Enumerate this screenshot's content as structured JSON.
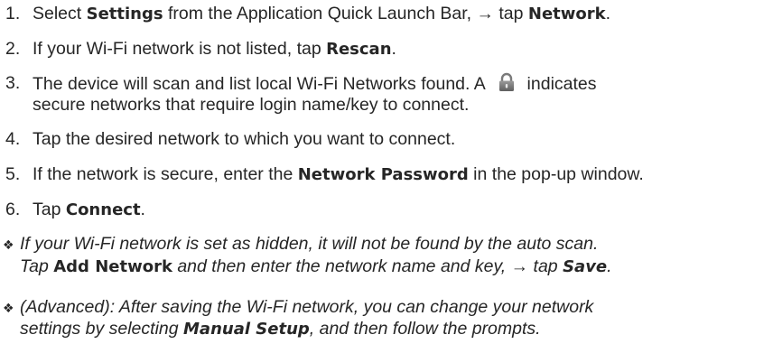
{
  "steps": [
    {
      "num": "1.",
      "parts": [
        "Select ",
        "Settings",
        " from the Application Quick Launch Bar, → tap ",
        "Network",
        "."
      ]
    },
    {
      "num": "2.",
      "parts": [
        "If your Wi-Fi network is not listed, tap ",
        "Rescan",
        "."
      ]
    },
    {
      "num": "3.",
      "line1": [
        "The device will scan and list local Wi-Fi Networks found. A ",
        " indicates"
      ],
      "line2": "secure networks that require login name/key to connect.",
      "icon": "padlock-icon"
    },
    {
      "num": "4.",
      "parts": [
        "Tap the desired network to which you want to connect."
      ]
    },
    {
      "num": "5.",
      "parts": [
        "If the network is secure, enter the ",
        "Network Password",
        " in the pop-up window."
      ]
    },
    {
      "num": "6.",
      "parts": [
        "Tap ",
        "Connect",
        "."
      ]
    }
  ],
  "notes": [
    {
      "bullet": "❖",
      "line1": "If your Wi-Fi network is set as hidden, it will not be found by the auto scan.",
      "line2": [
        "Tap ",
        "Add Network",
        " and then enter the network name and key, → tap ",
        "Save",
        "."
      ]
    },
    {
      "bullet": "❖",
      "line1": "(Advanced): After saving the Wi-Fi network, you can change your network",
      "line2": [
        "settings by selecting ",
        "Manual Setup",
        ", and then follow the prompts."
      ]
    }
  ]
}
